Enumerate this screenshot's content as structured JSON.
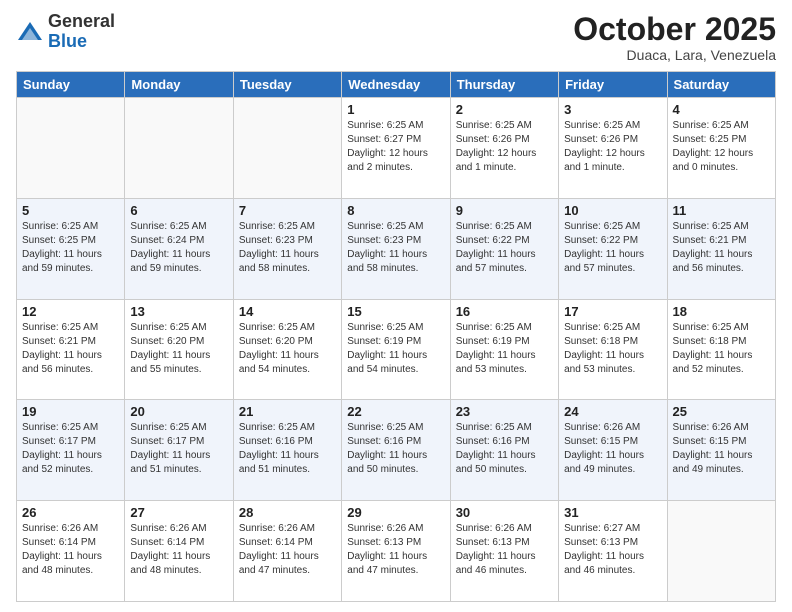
{
  "logo": {
    "line1": "General",
    "line2": "Blue"
  },
  "title": "October 2025",
  "location": "Duaca, Lara, Venezuela",
  "weekdays": [
    "Sunday",
    "Monday",
    "Tuesday",
    "Wednesday",
    "Thursday",
    "Friday",
    "Saturday"
  ],
  "weeks": [
    [
      {
        "day": "",
        "info": ""
      },
      {
        "day": "",
        "info": ""
      },
      {
        "day": "",
        "info": ""
      },
      {
        "day": "1",
        "info": "Sunrise: 6:25 AM\nSunset: 6:27 PM\nDaylight: 12 hours\nand 2 minutes."
      },
      {
        "day": "2",
        "info": "Sunrise: 6:25 AM\nSunset: 6:26 PM\nDaylight: 12 hours\nand 1 minute."
      },
      {
        "day": "3",
        "info": "Sunrise: 6:25 AM\nSunset: 6:26 PM\nDaylight: 12 hours\nand 1 minute."
      },
      {
        "day": "4",
        "info": "Sunrise: 6:25 AM\nSunset: 6:25 PM\nDaylight: 12 hours\nand 0 minutes."
      }
    ],
    [
      {
        "day": "5",
        "info": "Sunrise: 6:25 AM\nSunset: 6:25 PM\nDaylight: 11 hours\nand 59 minutes."
      },
      {
        "day": "6",
        "info": "Sunrise: 6:25 AM\nSunset: 6:24 PM\nDaylight: 11 hours\nand 59 minutes."
      },
      {
        "day": "7",
        "info": "Sunrise: 6:25 AM\nSunset: 6:23 PM\nDaylight: 11 hours\nand 58 minutes."
      },
      {
        "day": "8",
        "info": "Sunrise: 6:25 AM\nSunset: 6:23 PM\nDaylight: 11 hours\nand 58 minutes."
      },
      {
        "day": "9",
        "info": "Sunrise: 6:25 AM\nSunset: 6:22 PM\nDaylight: 11 hours\nand 57 minutes."
      },
      {
        "day": "10",
        "info": "Sunrise: 6:25 AM\nSunset: 6:22 PM\nDaylight: 11 hours\nand 57 minutes."
      },
      {
        "day": "11",
        "info": "Sunrise: 6:25 AM\nSunset: 6:21 PM\nDaylight: 11 hours\nand 56 minutes."
      }
    ],
    [
      {
        "day": "12",
        "info": "Sunrise: 6:25 AM\nSunset: 6:21 PM\nDaylight: 11 hours\nand 56 minutes."
      },
      {
        "day": "13",
        "info": "Sunrise: 6:25 AM\nSunset: 6:20 PM\nDaylight: 11 hours\nand 55 minutes."
      },
      {
        "day": "14",
        "info": "Sunrise: 6:25 AM\nSunset: 6:20 PM\nDaylight: 11 hours\nand 54 minutes."
      },
      {
        "day": "15",
        "info": "Sunrise: 6:25 AM\nSunset: 6:19 PM\nDaylight: 11 hours\nand 54 minutes."
      },
      {
        "day": "16",
        "info": "Sunrise: 6:25 AM\nSunset: 6:19 PM\nDaylight: 11 hours\nand 53 minutes."
      },
      {
        "day": "17",
        "info": "Sunrise: 6:25 AM\nSunset: 6:18 PM\nDaylight: 11 hours\nand 53 minutes."
      },
      {
        "day": "18",
        "info": "Sunrise: 6:25 AM\nSunset: 6:18 PM\nDaylight: 11 hours\nand 52 minutes."
      }
    ],
    [
      {
        "day": "19",
        "info": "Sunrise: 6:25 AM\nSunset: 6:17 PM\nDaylight: 11 hours\nand 52 minutes."
      },
      {
        "day": "20",
        "info": "Sunrise: 6:25 AM\nSunset: 6:17 PM\nDaylight: 11 hours\nand 51 minutes."
      },
      {
        "day": "21",
        "info": "Sunrise: 6:25 AM\nSunset: 6:16 PM\nDaylight: 11 hours\nand 51 minutes."
      },
      {
        "day": "22",
        "info": "Sunrise: 6:25 AM\nSunset: 6:16 PM\nDaylight: 11 hours\nand 50 minutes."
      },
      {
        "day": "23",
        "info": "Sunrise: 6:25 AM\nSunset: 6:16 PM\nDaylight: 11 hours\nand 50 minutes."
      },
      {
        "day": "24",
        "info": "Sunrise: 6:26 AM\nSunset: 6:15 PM\nDaylight: 11 hours\nand 49 minutes."
      },
      {
        "day": "25",
        "info": "Sunrise: 6:26 AM\nSunset: 6:15 PM\nDaylight: 11 hours\nand 49 minutes."
      }
    ],
    [
      {
        "day": "26",
        "info": "Sunrise: 6:26 AM\nSunset: 6:14 PM\nDaylight: 11 hours\nand 48 minutes."
      },
      {
        "day": "27",
        "info": "Sunrise: 6:26 AM\nSunset: 6:14 PM\nDaylight: 11 hours\nand 48 minutes."
      },
      {
        "day": "28",
        "info": "Sunrise: 6:26 AM\nSunset: 6:14 PM\nDaylight: 11 hours\nand 47 minutes."
      },
      {
        "day": "29",
        "info": "Sunrise: 6:26 AM\nSunset: 6:13 PM\nDaylight: 11 hours\nand 47 minutes."
      },
      {
        "day": "30",
        "info": "Sunrise: 6:26 AM\nSunset: 6:13 PM\nDaylight: 11 hours\nand 46 minutes."
      },
      {
        "day": "31",
        "info": "Sunrise: 6:27 AM\nSunset: 6:13 PM\nDaylight: 11 hours\nand 46 minutes."
      },
      {
        "day": "",
        "info": ""
      }
    ]
  ]
}
